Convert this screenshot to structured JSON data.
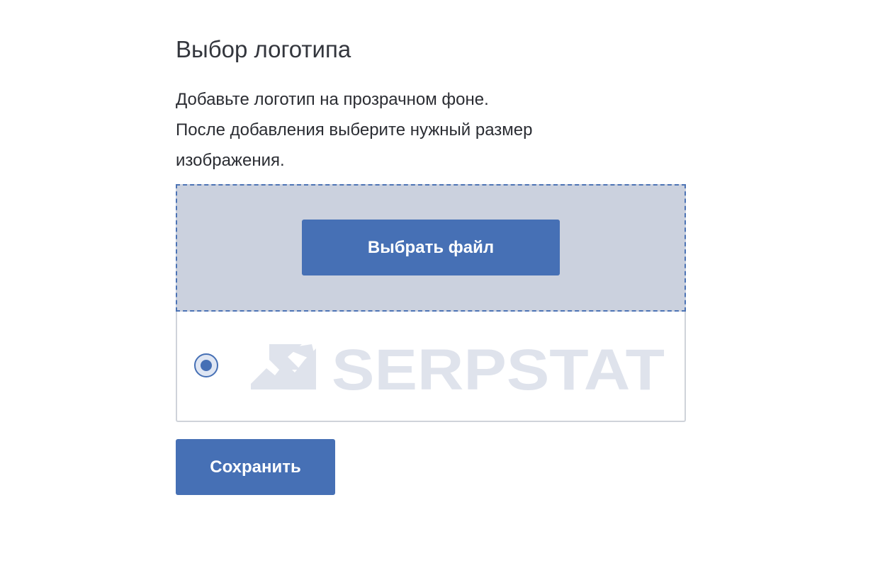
{
  "title": "Выбор логотипа",
  "description": {
    "line1": "Добавьте логотип на прозрачном фоне.",
    "line2": "После добавления выберите нужный размер",
    "line3": "изображения."
  },
  "upload": {
    "choose_file_label": "Выбрать файл"
  },
  "logo_option": {
    "selected": true,
    "logo_text": "SERPSTAT",
    "logo_icon": "serpstat-chart-arrow-icon",
    "logo_color": "#dfe3ec"
  },
  "actions": {
    "save_label": "Сохранить"
  },
  "colors": {
    "accent": "#4670b5",
    "dropzone_bg": "#cbd1de",
    "text": "#2b2d33"
  }
}
